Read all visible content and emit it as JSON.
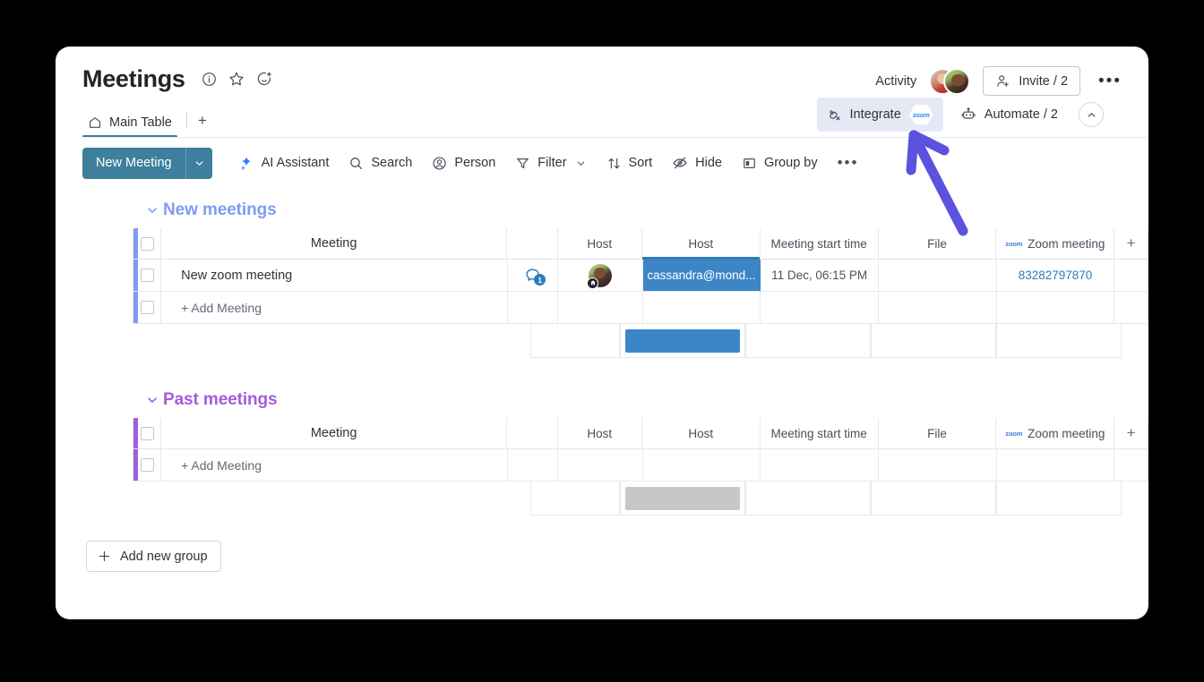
{
  "board": {
    "title": "Meetings",
    "title_icons": [
      "info-icon",
      "star-icon",
      "add-reaction-icon"
    ]
  },
  "header": {
    "activity_label": "Activity",
    "invite_label": "Invite / 2",
    "more_label": "•••"
  },
  "tabs": {
    "items": [
      {
        "label": "Main Table",
        "icon": "home-icon",
        "active": true
      }
    ],
    "add_label": "+",
    "integrate_label": "Integrate",
    "integrate_badge": "zoom",
    "automate_label": "Automate / 2",
    "collapse_icon": "chevron-up-icon"
  },
  "toolbar": {
    "new_item_label": "New Meeting",
    "new_item_caret": "chevron-down-icon",
    "items": [
      {
        "label": "AI Assistant",
        "icon": "ai-icon"
      },
      {
        "label": "Search",
        "icon": "search-icon"
      },
      {
        "label": "Person",
        "icon": "person-icon"
      },
      {
        "label": "Filter",
        "icon": "filter-icon",
        "caret": true
      },
      {
        "label": "Sort",
        "icon": "sort-icon"
      },
      {
        "label": "Hide",
        "icon": "hide-eye-icon"
      },
      {
        "label": "Group by",
        "icon": "group-by-icon"
      }
    ],
    "overflow_label": "•••"
  },
  "columns": [
    {
      "label": "Meeting",
      "key": "name"
    },
    {
      "label": "",
      "key": "conversation"
    },
    {
      "label": "Host",
      "key": "person"
    },
    {
      "label": "Host",
      "key": "people",
      "selected": true
    },
    {
      "label": "Meeting start time",
      "key": "time"
    },
    {
      "label": "File",
      "key": "file"
    },
    {
      "label": "Zoom meeting",
      "key": "zoom",
      "icon": "zoom-logo-icon"
    },
    {
      "label": "+",
      "key": "add-column"
    }
  ],
  "groups": [
    {
      "name": "New meetings",
      "color": "#7e9cf5",
      "collapse_icon": "chevron-down-icon",
      "rows": [
        {
          "name": "New zoom meeting",
          "conversation_count": "1",
          "person": "avatar",
          "people_value": "cassandra@mond...",
          "time": "11 Dec, 06:15 PM",
          "file": "",
          "zoom_meeting": "83282797870"
        }
      ],
      "add_row_label": "+ Add Meeting",
      "summary_bar_color": "#3d86c6"
    },
    {
      "name": "Past meetings",
      "color": "#a25ddc",
      "collapse_icon": "chevron-down-icon",
      "rows": [],
      "add_row_label": "+ Add Meeting",
      "summary_bar_color": "#c5c7c9"
    }
  ],
  "footer": {
    "add_group_label": "Add new group",
    "add_group_icon": "plus-icon"
  },
  "annotation": {
    "arrow_color": "#5b52e0",
    "points_to": "Integrate"
  },
  "colors": {
    "primary": "#3f7f9e",
    "selected_cell": "#3d86c6",
    "link": "#2e7cba",
    "group_new": "#7e9cf5",
    "group_past": "#a25ddc",
    "background": "#000000"
  }
}
